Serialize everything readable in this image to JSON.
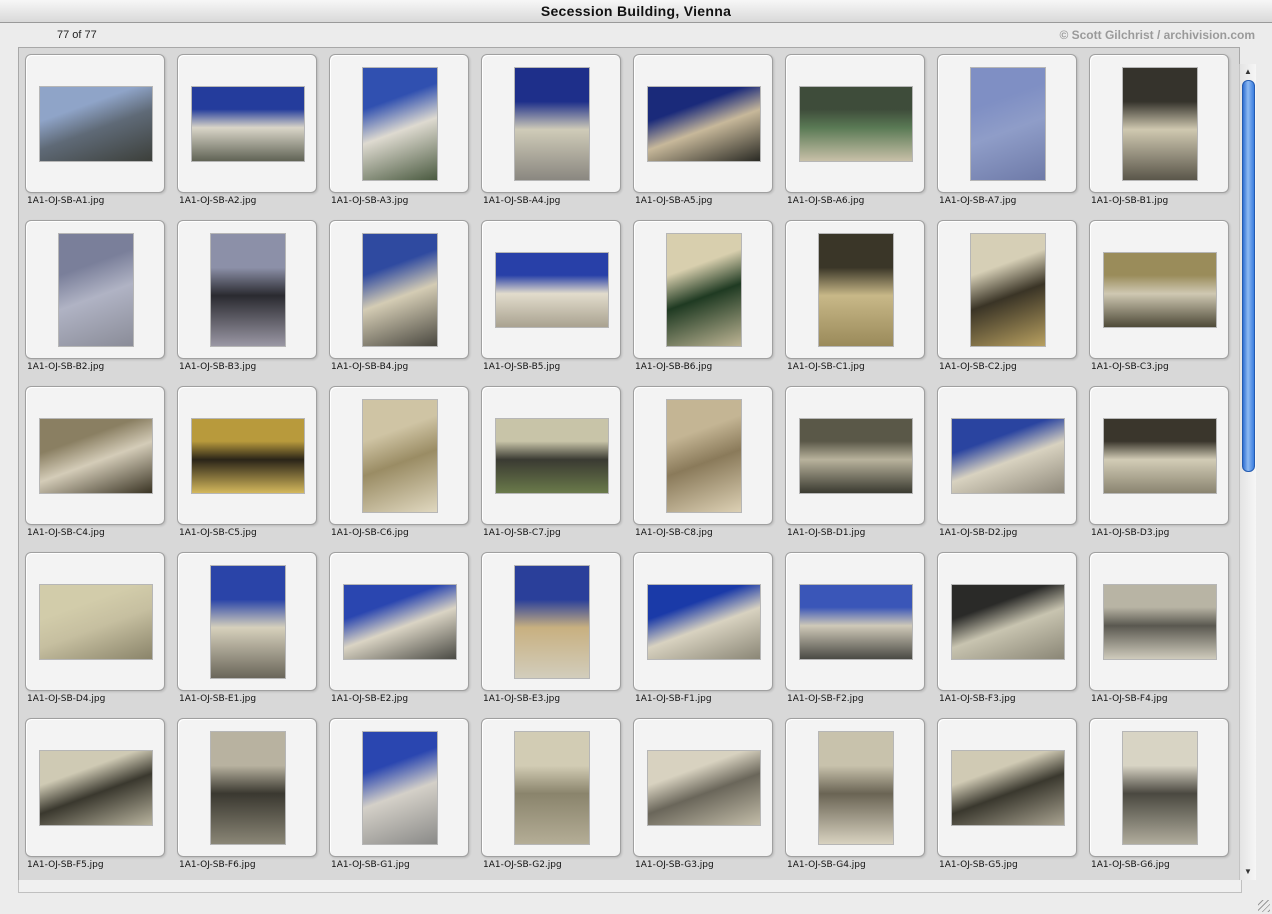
{
  "window": {
    "title": "Secession Building, Vienna",
    "count": "77 of 77",
    "copyright": "© Scott Gilchrist / archivision.com"
  },
  "images": [
    {
      "name": "1A1-OJ-SB-A1.jpg",
      "orientation": "landscape",
      "colors": [
        "#8fa4c8",
        "#5f6a77",
        "#3c3f3a"
      ]
    },
    {
      "name": "1A1-OJ-SB-A2.jpg",
      "orientation": "landscape",
      "colors": [
        "#243c9c",
        "#d9d5c8",
        "#606355"
      ]
    },
    {
      "name": "1A1-OJ-SB-A3.jpg",
      "orientation": "portrait",
      "colors": [
        "#3050b0",
        "#dedad0",
        "#4a5a40"
      ]
    },
    {
      "name": "1A1-OJ-SB-A4.jpg",
      "orientation": "portrait",
      "colors": [
        "#1e2f8a",
        "#cfcbb8",
        "#8a8780"
      ]
    },
    {
      "name": "1A1-OJ-SB-A5.jpg",
      "orientation": "landscape",
      "colors": [
        "#1a2a7a",
        "#c7b89a",
        "#2a2a24"
      ]
    },
    {
      "name": "1A1-OJ-SB-A6.jpg",
      "orientation": "landscape",
      "colors": [
        "#3e4c3a",
        "#5a7a55",
        "#c8c0a8"
      ]
    },
    {
      "name": "1A1-OJ-SB-A7.jpg",
      "orientation": "portrait",
      "colors": [
        "#7f8fc4",
        "#8f9dc8",
        "#6e7aa8"
      ]
    },
    {
      "name": "1A1-OJ-SB-B1.jpg",
      "orientation": "portrait",
      "colors": [
        "#35332c",
        "#cfc8b0",
        "#5a564a"
      ]
    },
    {
      "name": "1A1-OJ-SB-B2.jpg",
      "orientation": "portrait",
      "colors": [
        "#7a7f9a",
        "#b0b3c4",
        "#8a8c98"
      ]
    },
    {
      "name": "1A1-OJ-SB-B3.jpg",
      "orientation": "portrait",
      "colors": [
        "#8c90a8",
        "#2a2a30",
        "#9a97a4"
      ]
    },
    {
      "name": "1A1-OJ-SB-B4.jpg",
      "orientation": "portrait",
      "colors": [
        "#2f4aa0",
        "#d4ccb4",
        "#4a4840"
      ]
    },
    {
      "name": "1A1-OJ-SB-B5.jpg",
      "orientation": "landscape",
      "colors": [
        "#2840a8",
        "#e2dccc",
        "#a9a290"
      ]
    },
    {
      "name": "1A1-OJ-SB-B6.jpg",
      "orientation": "portrait",
      "colors": [
        "#d8cfae",
        "#1f3a22",
        "#bdb494"
      ]
    },
    {
      "name": "1A1-OJ-SB-C1.jpg",
      "orientation": "portrait",
      "colors": [
        "#3a3628",
        "#c8b888",
        "#9a8a5a"
      ]
    },
    {
      "name": "1A1-OJ-SB-C2.jpg",
      "orientation": "portrait",
      "colors": [
        "#d6cfb6",
        "#3a3426",
        "#b8a060"
      ]
    },
    {
      "name": "1A1-OJ-SB-C3.jpg",
      "orientation": "landscape",
      "colors": [
        "#9a8c5a",
        "#cfc8b2",
        "#4e4a38"
      ]
    },
    {
      "name": "1A1-OJ-SB-C4.jpg",
      "orientation": "landscape",
      "colors": [
        "#8a7f62",
        "#d4ccb8",
        "#3a3424"
      ]
    },
    {
      "name": "1A1-OJ-SB-C5.jpg",
      "orientation": "landscape",
      "colors": [
        "#b89a3c",
        "#2a2418",
        "#d4b85c"
      ]
    },
    {
      "name": "1A1-OJ-SB-C6.jpg",
      "orientation": "portrait",
      "colors": [
        "#cfc4a4",
        "#9a8c64",
        "#e0d8c0"
      ]
    },
    {
      "name": "1A1-OJ-SB-C7.jpg",
      "orientation": "landscape",
      "colors": [
        "#c8c4a8",
        "#3a3a32",
        "#6a7a4a"
      ]
    },
    {
      "name": "1A1-OJ-SB-C8.jpg",
      "orientation": "portrait",
      "colors": [
        "#c4b594",
        "#8a7a5a",
        "#dcd0b4"
      ]
    },
    {
      "name": "1A1-OJ-SB-D1.jpg",
      "orientation": "landscape",
      "colors": [
        "#5a5848",
        "#b8b29c",
        "#3a3a30"
      ]
    },
    {
      "name": "1A1-OJ-SB-D2.jpg",
      "orientation": "landscape",
      "colors": [
        "#2a44a0",
        "#d8d2c0",
        "#8e887a"
      ]
    },
    {
      "name": "1A1-OJ-SB-D3.jpg",
      "orientation": "landscape",
      "colors": [
        "#3a362c",
        "#d2ccb6",
        "#8a8470"
      ]
    },
    {
      "name": "1A1-OJ-SB-D4.jpg",
      "orientation": "landscape",
      "colors": [
        "#d2ccaa",
        "#c6bfa0",
        "#8a846a"
      ]
    },
    {
      "name": "1A1-OJ-SB-E1.jpg",
      "orientation": "portrait",
      "colors": [
        "#2a44a8",
        "#d6d0bc",
        "#6a665a"
      ]
    },
    {
      "name": "1A1-OJ-SB-E2.jpg",
      "orientation": "landscape",
      "colors": [
        "#2a46b0",
        "#dad4c4",
        "#4a4a44"
      ]
    },
    {
      "name": "1A1-OJ-SB-E3.jpg",
      "orientation": "portrait",
      "colors": [
        "#2a3f9a",
        "#c8b080",
        "#d2cdbc"
      ]
    },
    {
      "name": "1A1-OJ-SB-F1.jpg",
      "orientation": "landscape",
      "colors": [
        "#1a3aa8",
        "#d8d2c0",
        "#8a8676"
      ]
    },
    {
      "name": "1A1-OJ-SB-F2.jpg",
      "orientation": "landscape",
      "colors": [
        "#3a56b8",
        "#cfc9b8",
        "#4a4a44"
      ]
    },
    {
      "name": "1A1-OJ-SB-F3.jpg",
      "orientation": "landscape",
      "colors": [
        "#2a2a28",
        "#c8c4b0",
        "#8a8676"
      ]
    },
    {
      "name": "1A1-OJ-SB-F4.jpg",
      "orientation": "landscape",
      "colors": [
        "#b8b4a4",
        "#5a5850",
        "#cfcbbc"
      ]
    },
    {
      "name": "1A1-OJ-SB-F5.jpg",
      "orientation": "landscape",
      "colors": [
        "#cfcab4",
        "#3a382e",
        "#b8b39e"
      ]
    },
    {
      "name": "1A1-OJ-SB-F6.jpg",
      "orientation": "portrait",
      "colors": [
        "#b8b2a0",
        "#3a3830",
        "#8a8676"
      ]
    },
    {
      "name": "1A1-OJ-SB-G1.jpg",
      "orientation": "portrait",
      "colors": [
        "#2a46b0",
        "#d4d0c8",
        "#8a8a88"
      ]
    },
    {
      "name": "1A1-OJ-SB-G2.jpg",
      "orientation": "portrait",
      "colors": [
        "#d2ccb4",
        "#8a846c",
        "#b4ad96"
      ]
    },
    {
      "name": "1A1-OJ-SB-G3.jpg",
      "orientation": "landscape",
      "colors": [
        "#d8d2c0",
        "#6a665a",
        "#c2bca8"
      ]
    },
    {
      "name": "1A1-OJ-SB-G4.jpg",
      "orientation": "portrait",
      "colors": [
        "#c8c2ac",
        "#6a6454",
        "#d8d2c0"
      ]
    },
    {
      "name": "1A1-OJ-SB-G5.jpg",
      "orientation": "landscape",
      "colors": [
        "#d0cab4",
        "#3a382e",
        "#a8a290"
      ]
    },
    {
      "name": "1A1-OJ-SB-G6.jpg",
      "orientation": "portrait",
      "colors": [
        "#d8d4c4",
        "#4a4840",
        "#b0ac9c"
      ]
    }
  ]
}
